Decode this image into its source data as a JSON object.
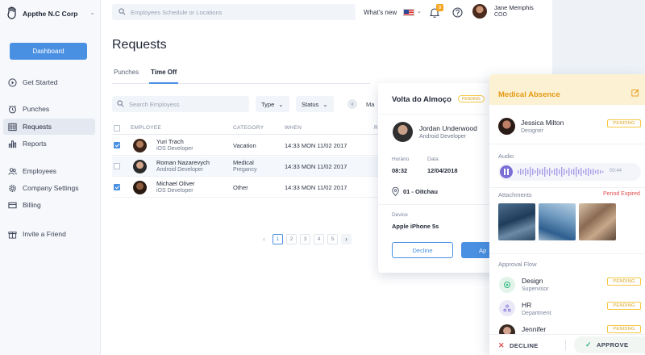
{
  "brand": {
    "name": "Appthe N.C Corp"
  },
  "sidebar": {
    "dashboard_label": "Dashboard",
    "items": [
      {
        "label": "Get Started",
        "icon": "play-circle-icon"
      },
      {
        "label": "Punches",
        "icon": "alarm-clock-icon"
      },
      {
        "label": "Requests",
        "icon": "calendar-grid-icon"
      },
      {
        "label": "Reports",
        "icon": "bar-chart-icon"
      },
      {
        "label": "Employees",
        "icon": "users-icon"
      },
      {
        "label": "Company Settings",
        "icon": "gear-icon"
      },
      {
        "label": "Billing",
        "icon": "billing-icon"
      },
      {
        "label": "Invite a Friend",
        "icon": "gift-icon"
      }
    ]
  },
  "header": {
    "search_placeholder": "Employees Schedule or Locations",
    "whats_new": "What's new",
    "notification_count": "8",
    "user": {
      "name": "Jane Memphis",
      "role": "COO"
    }
  },
  "main": {
    "title": "Requests",
    "tabs": [
      {
        "label": "Punches"
      },
      {
        "label": "Time Off"
      }
    ],
    "filters": {
      "search_placeholder": "Search Employess",
      "type_label": "Type",
      "status_label": "Status",
      "partial_text": "Ma"
    },
    "table": {
      "headers": [
        "EMPLOYEE",
        "CATEGORY",
        "WHEN",
        "R"
      ],
      "rows": [
        {
          "name": "Yuri Trach",
          "title": "iOS Developer",
          "category": "Vacation",
          "category_sub": "",
          "when": "14:33 MON 11/02 2017",
          "checked": true
        },
        {
          "name": "Roman Nazarevych",
          "title": "Android Developer",
          "category": "Medical",
          "category_sub": "Pregancy",
          "when": "14:33 MON 11/02 2017",
          "checked": false
        },
        {
          "name": "Michael Oliver",
          "title": "iOS Developer",
          "category": "Other",
          "category_sub": "",
          "when": "14:33 MON 11/02 2017",
          "checked": true
        }
      ]
    },
    "pagination": {
      "pages": [
        "1",
        "2",
        "3",
        "4",
        "5"
      ],
      "current": "1"
    }
  },
  "detail_card": {
    "title": "Volta do Almoço",
    "status": "PENDING",
    "employee_name": "Jordan Underwood",
    "employee_title": "Android Developer",
    "time_label": "Horário",
    "time_value": "08:32",
    "date_label": "Data",
    "date_value": "12/04/2018",
    "location": "01 - Oitchau",
    "device_label": "Device",
    "device_value": "Apple iPhone 5s",
    "decline_label": "Decline",
    "approve_label": "Ap"
  },
  "absence_card": {
    "title": "Medical Absence",
    "person": {
      "name": "Jessica Milton",
      "role": "Designer",
      "status": "PENDING"
    },
    "audio_label": "Audio",
    "audio_duration": "00:44",
    "attachments_label": "Attachments",
    "attachments_note": "Period Expired",
    "approval_flow_label": "Approval Flow",
    "flow": [
      {
        "name": "Design",
        "sub": "Supervisor",
        "status": "PENDING"
      },
      {
        "name": "HR",
        "sub": "Department",
        "status": "PENDING"
      },
      {
        "name": "Jennifer",
        "sub": "",
        "status": "PENDING"
      }
    ],
    "decline_label": "DECLINE",
    "approve_label": "APPROVE"
  },
  "colors": {
    "accent": "#4a90e2",
    "warning": "#f5a623",
    "danger": "#e05050",
    "success": "#2eb67d"
  }
}
